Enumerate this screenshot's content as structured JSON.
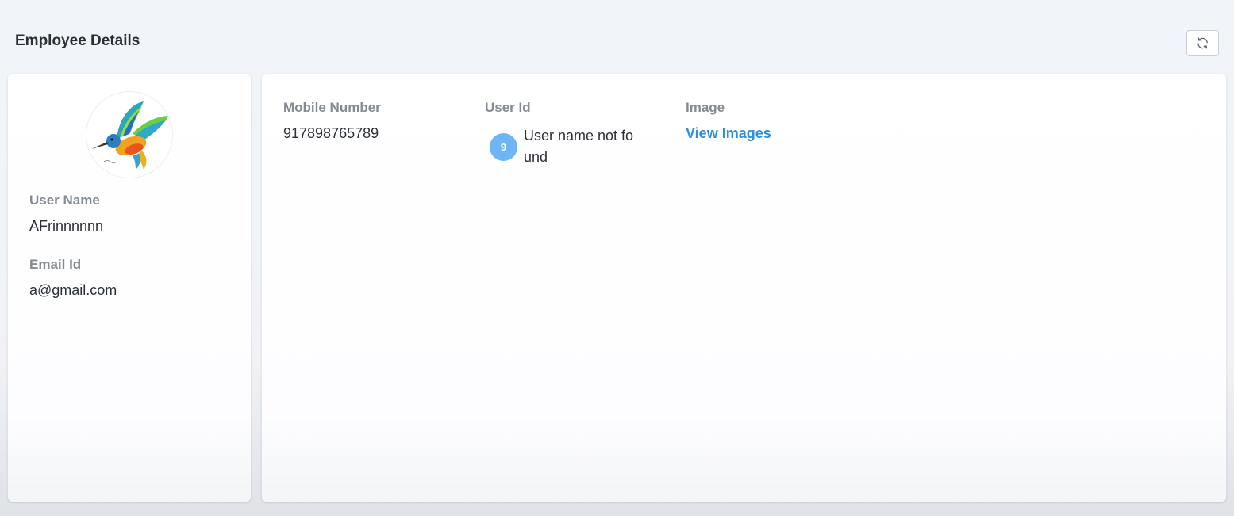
{
  "header": {
    "title": "Employee Details",
    "refresh_icon": "refresh-icon"
  },
  "profile": {
    "avatar_icon": "hummingbird-avatar",
    "user_name_label": "User Name",
    "user_name": "AFrinnnnnn",
    "email_label": "Email Id",
    "email": "a@gmail.com"
  },
  "details": {
    "mobile_label": "Mobile Number",
    "mobile": "917898765789",
    "user_id_label": "User Id",
    "user_badge": "9",
    "user_id_text": "User name not found",
    "image_label": "Image",
    "view_images": "View Images"
  },
  "colors": {
    "accent": "#2f8fd8",
    "badge": "#6eb5f5"
  }
}
